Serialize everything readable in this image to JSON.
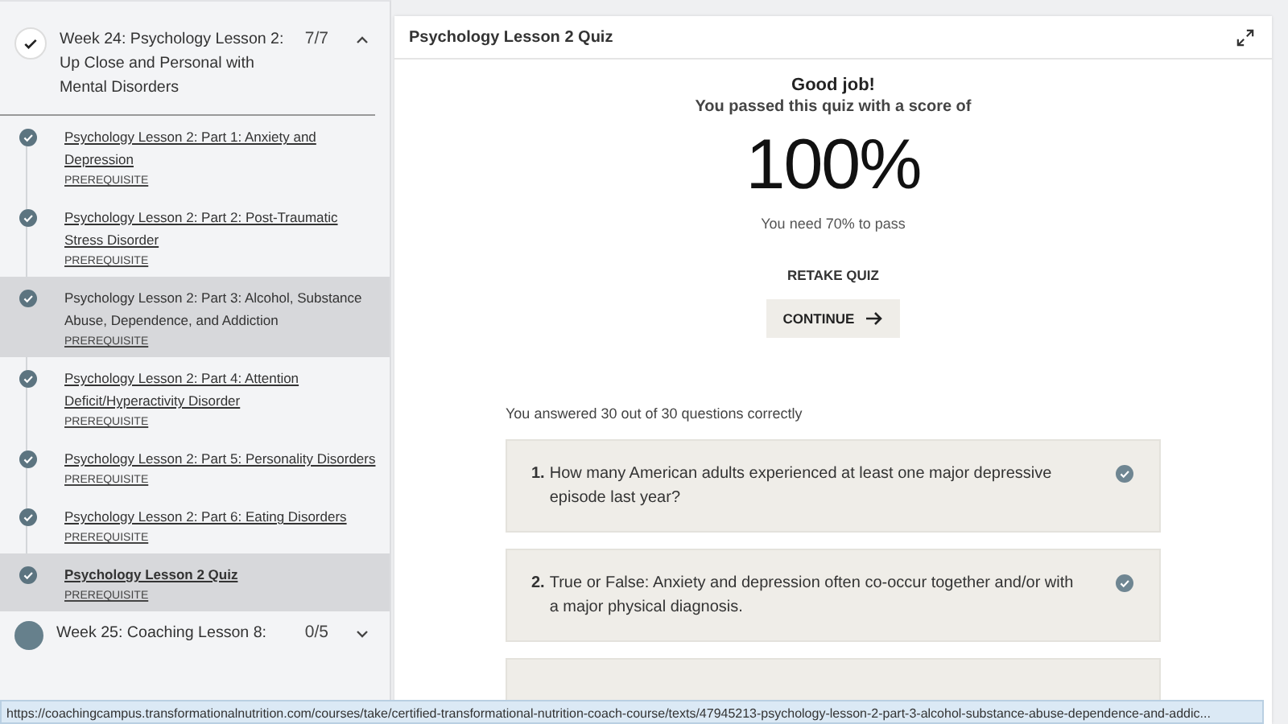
{
  "sidebar": {
    "weeks": [
      {
        "title": "Week 24: Psychology Lesson 2: Up Close and Personal with Mental Disorders",
        "progress": "7/7",
        "complete": true,
        "expanded": true,
        "items": [
          {
            "title": "Psychology Lesson 2: Part 1: Anxiety and Depression",
            "tag": "PREREQUISITE",
            "done": true,
            "selected": false,
            "hovered": false
          },
          {
            "title": "Psychology Lesson 2: Part 2: Post-Traumatic Stress Disorder",
            "tag": "PREREQUISITE",
            "done": true,
            "selected": false,
            "hovered": false
          },
          {
            "title": "Psychology Lesson 2: Part 3: Alcohol, Substance Abuse, Dependence, and Addiction",
            "tag": "PREREQUISITE",
            "done": true,
            "selected": false,
            "hovered": true
          },
          {
            "title": "Psychology Lesson 2: Part 4: Attention Deficit/Hyperactivity Disorder",
            "tag": "PREREQUISITE",
            "done": true,
            "selected": false,
            "hovered": false
          },
          {
            "title": "Psychology Lesson 2: Part 5: Personality Disorders",
            "tag": "PREREQUISITE",
            "done": true,
            "selected": false,
            "hovered": false
          },
          {
            "title": "Psychology Lesson 2: Part 6: Eating Disorders",
            "tag": "PREREQUISITE",
            "done": true,
            "selected": false,
            "hovered": false
          },
          {
            "title": "Psychology Lesson 2 Quiz",
            "tag": "PREREQUISITE",
            "done": true,
            "selected": true,
            "hovered": false
          }
        ]
      },
      {
        "title": "Week 25: Coaching Lesson 8:",
        "progress": "0/5",
        "complete": false,
        "expanded": false
      }
    ]
  },
  "quiz": {
    "title": "Psychology Lesson 2 Quiz",
    "heading": "Good job!",
    "subtitle": "You passed this quiz with a score of",
    "score": "100%",
    "requirement": "You need 70% to pass",
    "retake": "RETAKE QUIZ",
    "continue": "CONTINUE",
    "summary": "You answered 30 out of 30 questions correctly",
    "questions": [
      {
        "number": "1.",
        "text": "How many American adults experienced at least one major depressive episode last year?",
        "correct": true
      },
      {
        "number": "2.",
        "text": "True or False: Anxiety and depression often co-occur together and/or with a major physical diagnosis.",
        "correct": true
      },
      {
        "kind": "cut"
      }
    ]
  },
  "status_bar": "https://coachingcampus.transformationalnutrition.com/courses/take/certified-transformational-nutrition-coach-course/texts/47945213-psychology-lesson-2-part-3-alcohol-substance-abuse-dependence-and-addic..."
}
